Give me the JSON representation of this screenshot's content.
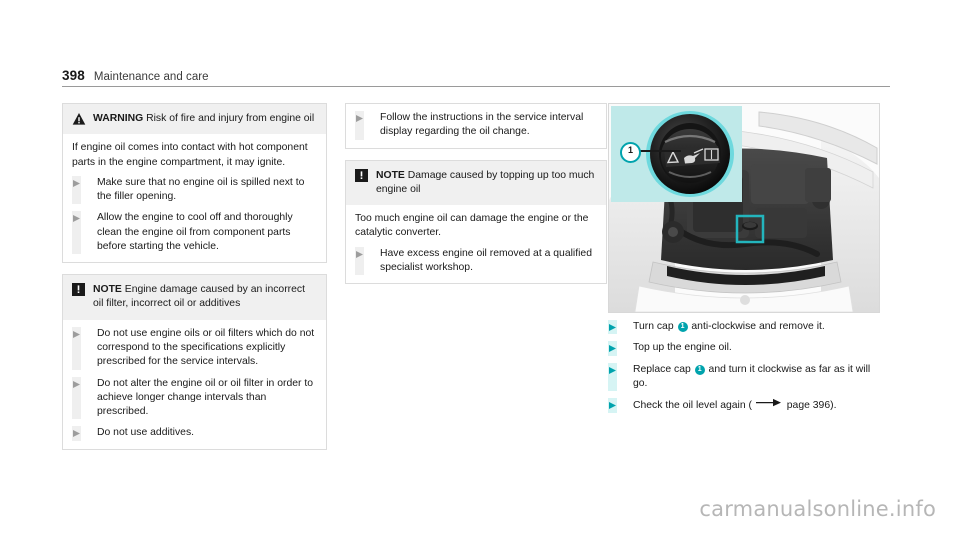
{
  "runhead": {
    "page_number": "398",
    "section_title": "Maintenance and care"
  },
  "column1": {
    "warning_box": {
      "icon": "warning-triangle-icon",
      "label": "WARNING",
      "heading": "Risk of fire and injury from engine oil",
      "paragraph": "If engine oil comes into contact with hot component parts in the engine compartment, it may ignite.",
      "bullets": [
        "Make sure that no engine oil is spilled next to the filler opening.",
        "Allow the engine to cool off and thoroughly clean the engine oil from component parts before starting the vehicle."
      ]
    },
    "note_box": {
      "icon": "note-exclamation-icon",
      "label": "NOTE",
      "heading": "Engine damage caused by an incorrect oil filter, incorrect oil or additives",
      "bullets": [
        "Do not use engine oils or oil filters which do not correspond to the specifications explicitly prescribed for the service intervals.",
        "Do not alter the engine oil or oil filter in order to achieve longer change intervals than prescribed.",
        "Do not use additives."
      ]
    }
  },
  "column2": {
    "continued_box": {
      "bullets": [
        "Follow the instructions in the service interval display regarding the oil change."
      ]
    },
    "note_box": {
      "icon": "note-exclamation-icon",
      "label": "NOTE",
      "heading": "Damage caused by topping up too much engine oil",
      "paragraph": "Too much engine oil can damage the engine or the catalytic converter.",
      "bullets": [
        "Have excess engine oil removed at a qualified specialist workshop."
      ]
    }
  },
  "column3": {
    "figure": {
      "alt": "engine-compartment-oil-filler-cap-photo",
      "inset_alt": "oil-filler-cap-closeup",
      "callout_number": "1"
    },
    "steps": [
      {
        "before": "Turn cap",
        "badge": "1",
        "after": "anti-clockwise and remove it."
      },
      {
        "before": "Top up the engine oil.",
        "badge": "",
        "after": ""
      },
      {
        "before": "Replace cap",
        "badge": "1",
        "after": "and turn it clockwise as far as it will go."
      },
      {
        "before": "Check the oil level again (",
        "badge": "",
        "after": "page 396)."
      }
    ]
  },
  "watermark": "carmanualsonline.info",
  "colors": {
    "teal_accent": "#00a3ad",
    "teal_bar": "#d6f4f4",
    "inset_background": "#bfe9e9",
    "box_header_gray": "#f0f0f0",
    "box_border_gray": "#dcdcdc",
    "bullet_bar_gray": "#efefef",
    "rule_gray": "#9a9a9a",
    "watermark_gray": "#b6b6b6"
  }
}
